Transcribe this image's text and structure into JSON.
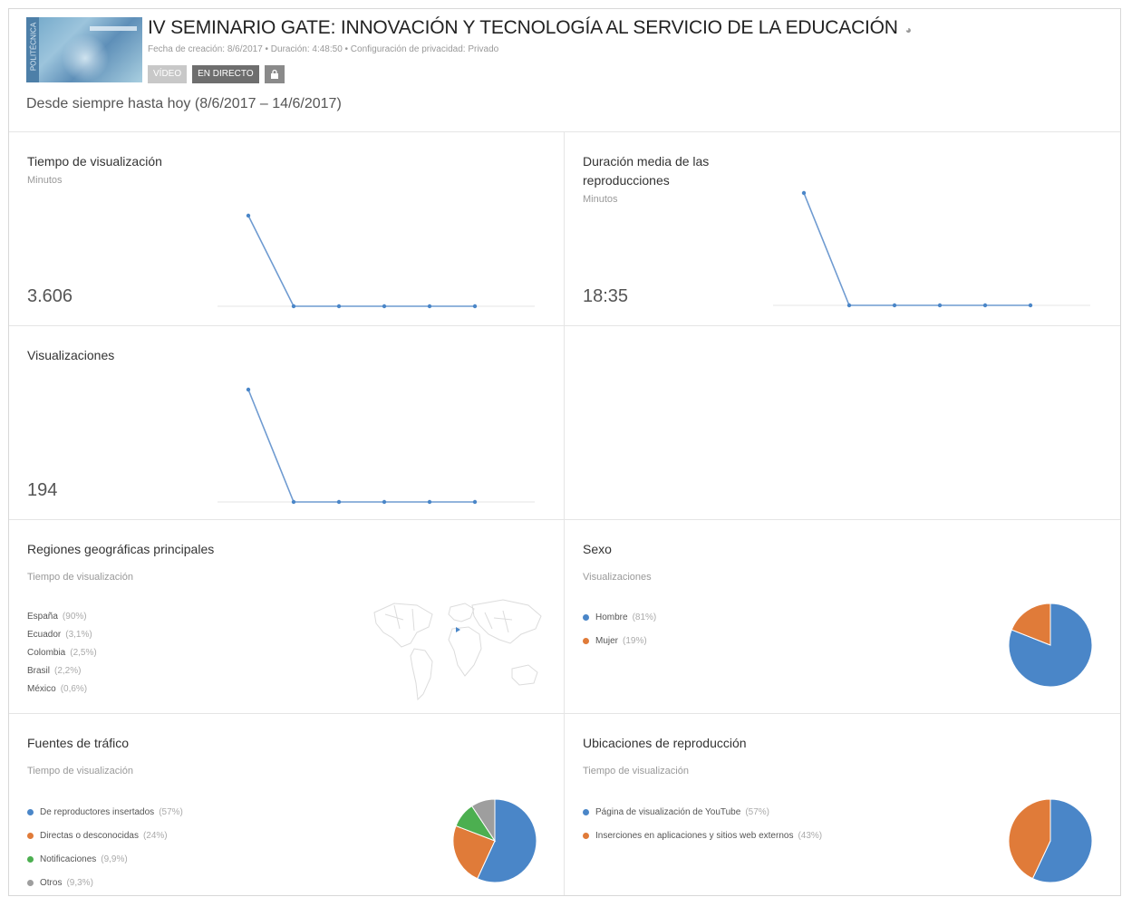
{
  "header": {
    "title": "IV SEMINARIO GATE: INNOVACIÓN Y TECNOLOGÍA AL SERVICIO DE LA EDUCACIÓN",
    "meta": "Fecha de creación: 8/6/2017 • Duración: 4:48:50 • Configuración de privacidad: Privado",
    "badge_video": "VÍDEO",
    "badge_live": "EN DIRECTO",
    "date_range": "Desde siempre hasta hoy (8/6/2017 – 14/6/2017)",
    "thumb_strip_text": "POLITÉCNICA"
  },
  "watch_time": {
    "title": "Tiempo de visualización",
    "unit": "Minutos",
    "value": "3.606"
  },
  "avg_duration": {
    "title_line1": "Duración media de las",
    "title_line2": "reproducciones",
    "unit": "Minutos",
    "value": "18:35"
  },
  "views": {
    "title": "Visualizaciones",
    "value": "194"
  },
  "regions": {
    "title": "Regiones geográficas principales",
    "subtitle": "Tiempo de visualización",
    "items": [
      {
        "label": "España",
        "pct": "(90%)"
      },
      {
        "label": "Ecuador",
        "pct": "(3,1%)"
      },
      {
        "label": "Colombia",
        "pct": "(2,5%)"
      },
      {
        "label": "Brasil",
        "pct": "(2,2%)"
      },
      {
        "label": "México",
        "pct": "(0,6%)"
      }
    ]
  },
  "gender": {
    "title": "Sexo",
    "subtitle": "Visualizaciones",
    "items": [
      {
        "label": "Hombre",
        "pct": "(81%)",
        "color": "#4a86c8"
      },
      {
        "label": "Mujer",
        "pct": "(19%)",
        "color": "#e07b39"
      }
    ]
  },
  "traffic": {
    "title": "Fuentes de tráfico",
    "subtitle": "Tiempo de visualización",
    "items": [
      {
        "label": "De reproductores insertados",
        "pct": "(57%)",
        "color": "#4a86c8"
      },
      {
        "label": "Directas o desconocidas",
        "pct": "(24%)",
        "color": "#e07b39"
      },
      {
        "label": "Notificaciones",
        "pct": "(9,9%)",
        "color": "#4caf50"
      },
      {
        "label": "Otros",
        "pct": "(9,3%)",
        "color": "#9e9e9e"
      }
    ]
  },
  "locations": {
    "title": "Ubicaciones de reproducción",
    "subtitle": "Tiempo de visualización",
    "items": [
      {
        "label": "Página de visualización de YouTube",
        "pct": "(57%)",
        "color": "#4a86c8"
      },
      {
        "label": "Inserciones en aplicaciones y sitios web externos",
        "pct": "(43%)",
        "color": "#e07b39"
      }
    ]
  },
  "chart_data": [
    {
      "type": "line",
      "name": "watch_time_spark",
      "values": [
        3606,
        0,
        0,
        0,
        0,
        0
      ]
    },
    {
      "type": "line",
      "name": "avg_duration_spark",
      "values": [
        18.58,
        0,
        0,
        0,
        0,
        0
      ]
    },
    {
      "type": "line",
      "name": "views_spark",
      "values": [
        194,
        0,
        0,
        0,
        0,
        0
      ]
    },
    {
      "type": "pie",
      "name": "gender_pie",
      "values": [
        81,
        19
      ]
    },
    {
      "type": "pie",
      "name": "traffic_pie",
      "values": [
        57,
        24,
        9.9,
        9.3
      ]
    },
    {
      "type": "pie",
      "name": "locations_pie",
      "values": [
        57,
        43
      ]
    }
  ]
}
